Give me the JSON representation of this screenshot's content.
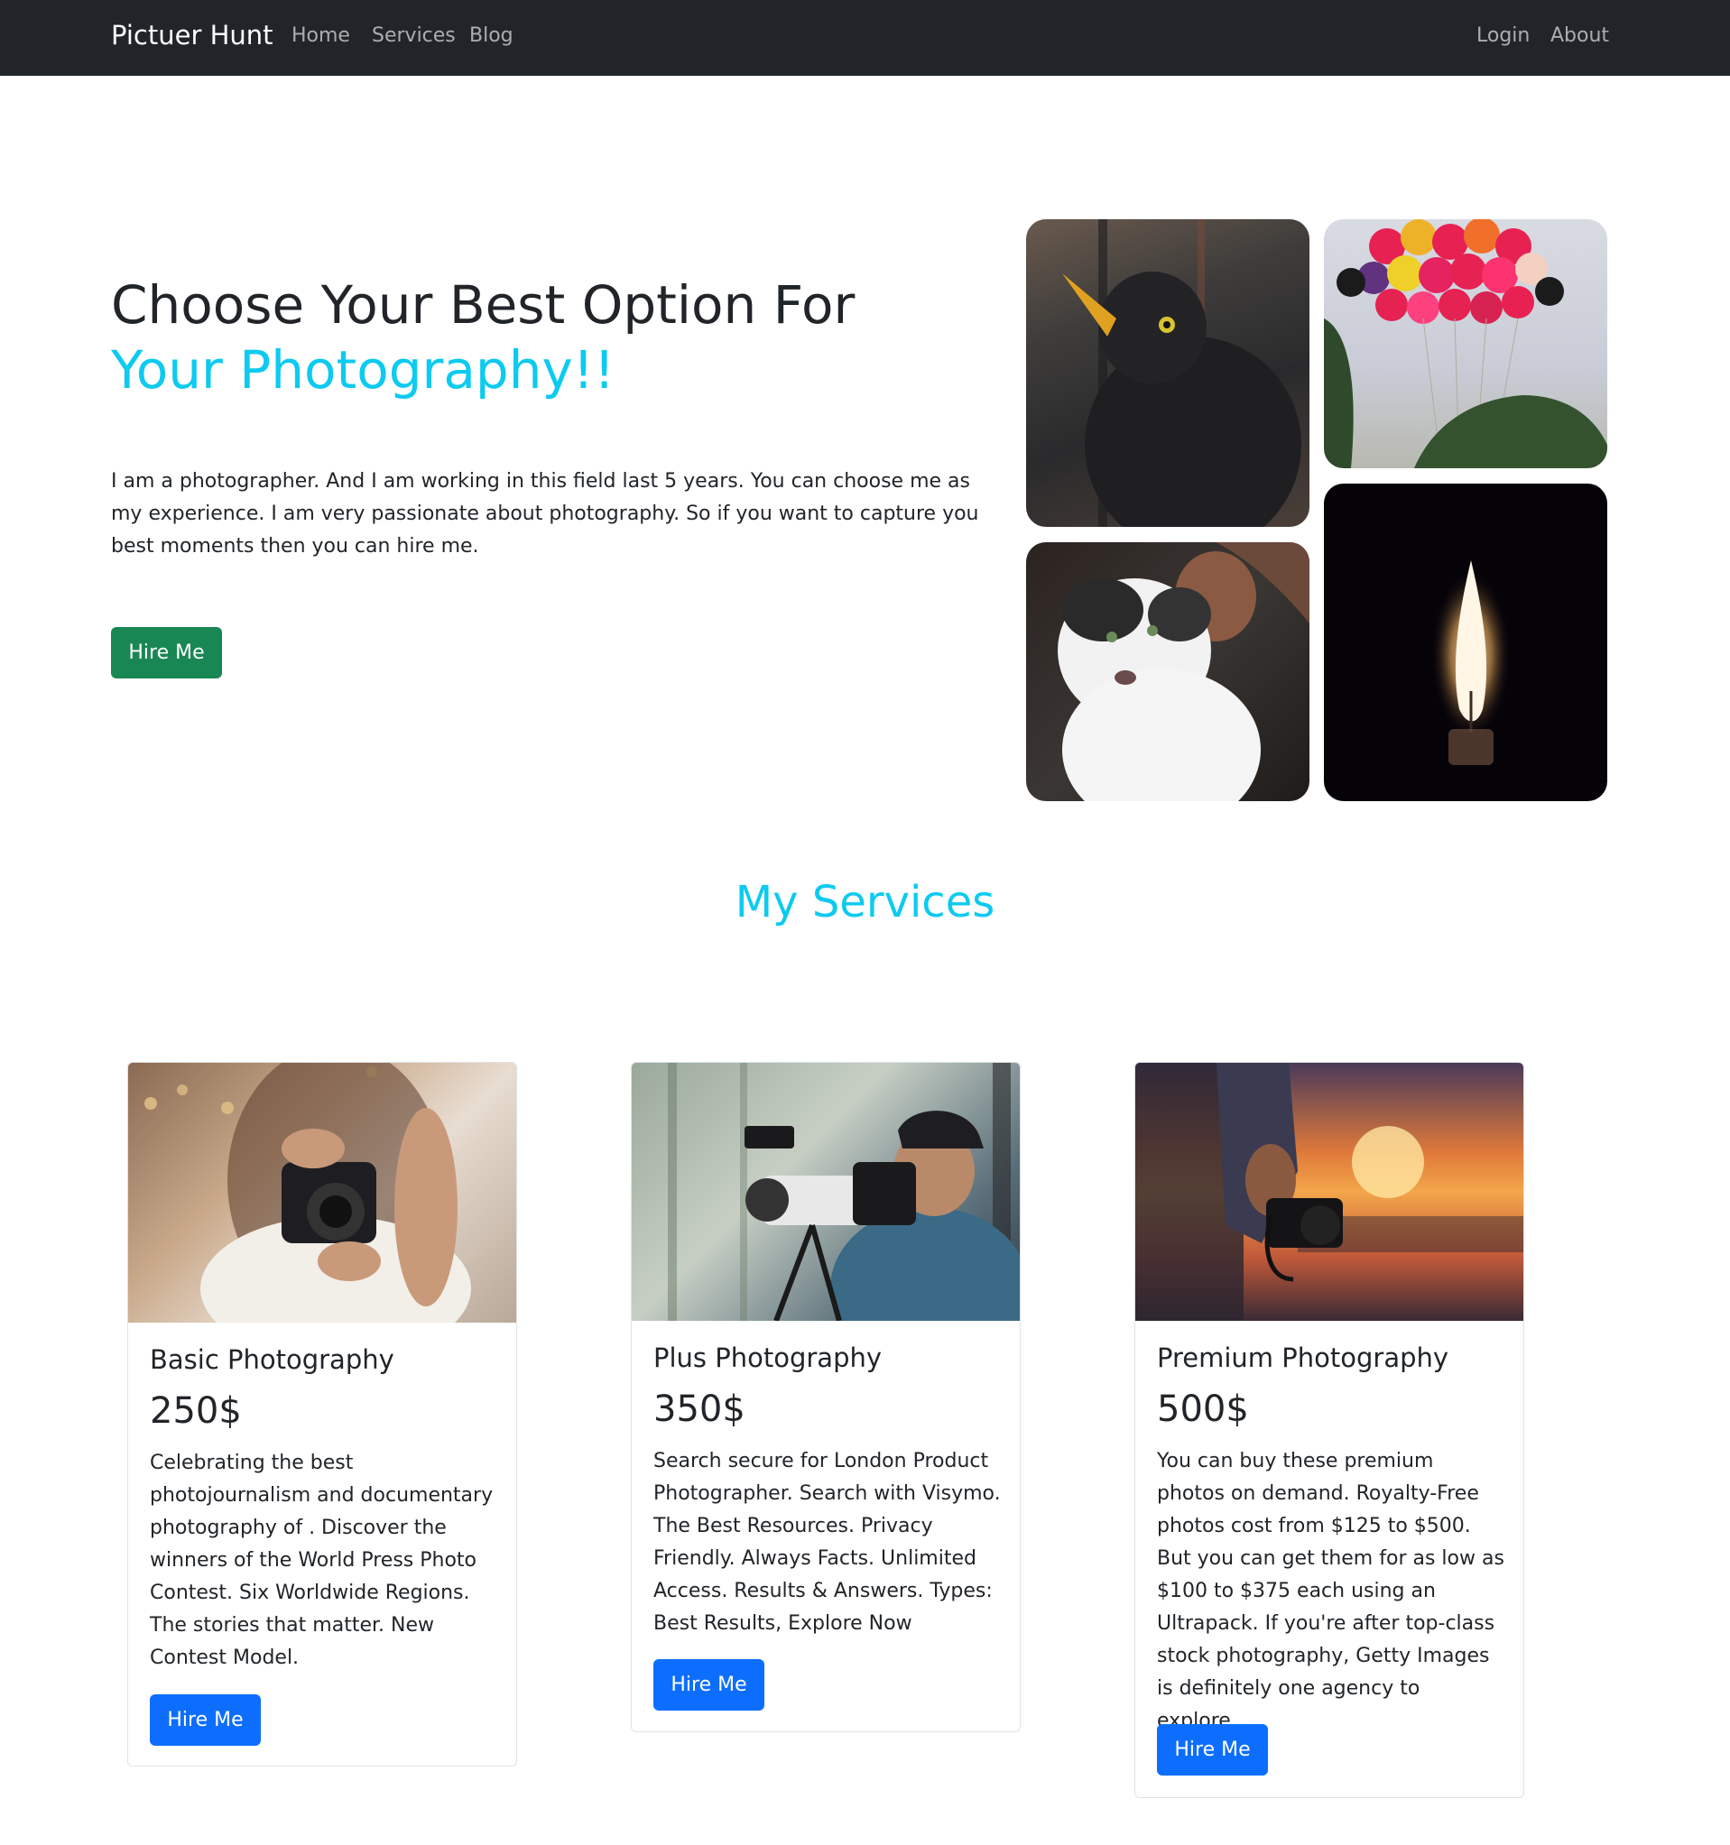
{
  "navbar": {
    "brand": "Pictuer Hunt",
    "links": [
      "Home",
      "Services",
      "Blog"
    ],
    "right_links": [
      "Login",
      "About"
    ]
  },
  "hero": {
    "title_line1": "Choose Your Best Option For",
    "title_line2": "Your Photography!!",
    "text": "I am a photographer. And I am working in this field last 5 years. You can choose me as my experience. I am very passionate about photography. So if you want to capture you best moments then you can hire me.",
    "button": "Hire Me"
  },
  "services": {
    "title": "My Services",
    "cards": [
      {
        "title": "Basic Photography",
        "price": "250$",
        "text": "Celebrating the best photojournalism and documentary photography of . Discover the winners of the World Press Photo Contest. Six Worldwide Regions. The stories that matter. New Contest Model.",
        "button": "Hire Me"
      },
      {
        "title": "Plus Photography",
        "price": "350$",
        "text": "Search secure for London Product Photographer. Search with Visymo. The Best Resources. Privacy Friendly. Always Facts. Unlimited Access. Results & Answers. Types: Best Results, Explore Now",
        "button": "Hire Me"
      },
      {
        "title": "Premium Photography",
        "price": "500$",
        "text": "You can buy these premium photos on demand. Royalty-Free photos cost from $125 to $500. But you can get them for as low as $100 to $375 each using an Ultrapack. If you're after top-class stock photography, Getty Images is definitely one agency to explore.",
        "button": "Hire Me"
      }
    ]
  },
  "colors": {
    "navbar_bg": "#212529",
    "accent": "#0dcaf0",
    "success": "#198754",
    "primary": "#0d6efd"
  }
}
